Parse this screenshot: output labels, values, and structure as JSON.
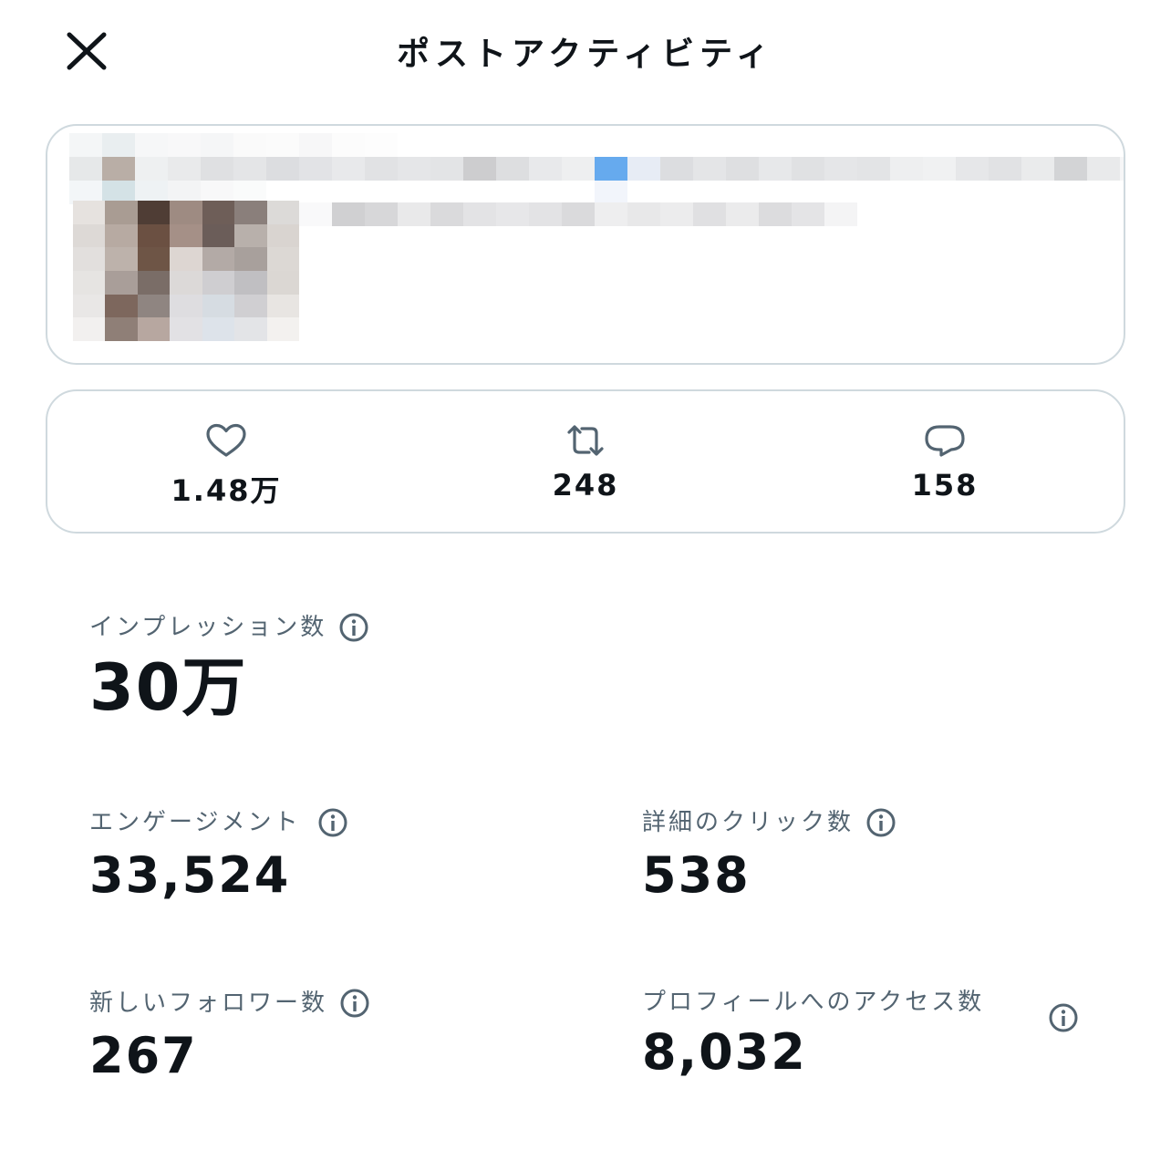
{
  "header": {
    "title": "ポストアクティビティ"
  },
  "post_preview": {
    "note": ""
  },
  "engagement_bar": {
    "likes": "1.48万",
    "reposts": "248",
    "replies": "158"
  },
  "metrics": {
    "impressions": {
      "label": "インプレッション数",
      "value": "30万"
    },
    "engagements": {
      "label": "エンゲージメント",
      "value": "33,524"
    },
    "detail_clicks": {
      "label": "詳細のクリック数",
      "value": "538"
    },
    "new_followers": {
      "label": "新しいフォロワー数",
      "value": "267"
    },
    "profile_visits": {
      "label": "プロフィールへのアクセス数",
      "value": "8,032"
    }
  },
  "colors": {
    "text_primary": "#0f1419",
    "text_secondary": "#536471",
    "border": "#cfd9de",
    "icon": "#536471"
  },
  "icons": [
    "close-icon",
    "heart-icon",
    "repost-icon",
    "reply-icon",
    "info-icon"
  ]
}
